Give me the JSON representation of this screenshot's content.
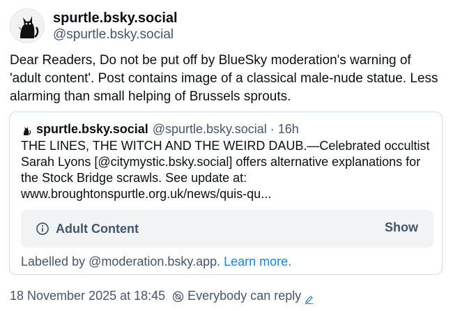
{
  "author": {
    "display_name": "spurtle.bsky.social",
    "handle": "@spurtle.bsky.social"
  },
  "post": {
    "text": "Dear Readers, Do not be put off by BlueSky moderation's warning of 'adult content'. Post contains image of a classical male-nude statue. Less alarming than small helping of Brussels sprouts."
  },
  "quote": {
    "display_name": "spurtle.bsky.social",
    "handle": "@spurtle.bsky.social",
    "separator": "·",
    "time": "16h",
    "text": "THE LINES, THE WITCH AND THE WEIRD DAUB.—Celebrated occultist Sarah Lyons [@citymystic.bsky.social] offers alternative explanations for the Stock Bridge scrawls. See update at:  www.broughtonspurtle.org.uk/news/quis-qu...",
    "warning_label": "Adult Content",
    "show_label": "Show",
    "labelled_by": "Labelled by @moderation.bsky.app.",
    "learn_more": "Learn more."
  },
  "footer": {
    "timestamp": "18 November 2025 at 18:45",
    "reply_setting": "Everybody can reply"
  },
  "colors": {
    "text": "#0b0f14",
    "muted": "#42576c",
    "link": "#1083fe",
    "border": "#d4dbe2",
    "warning_bg": "#f1f3f5"
  },
  "icons": [
    "avatar-cat",
    "info-icon",
    "reply-settings-icon",
    "pencil-icon"
  ]
}
